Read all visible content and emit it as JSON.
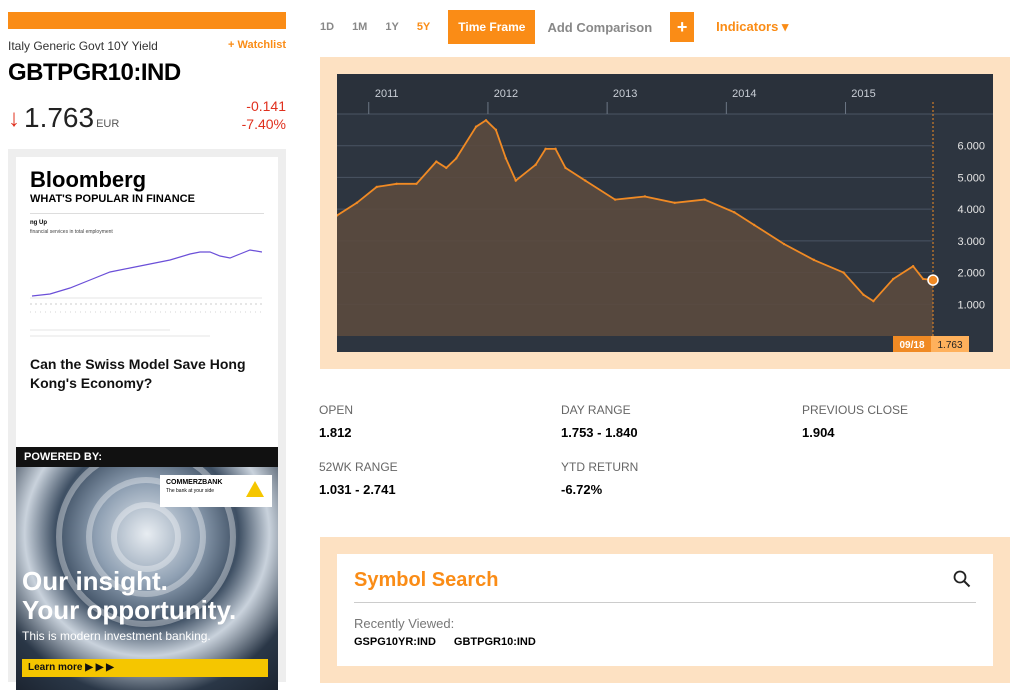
{
  "quote": {
    "name": "Italy Generic Govt 10Y Yield",
    "watchlist": "+ Watchlist",
    "ticker": "GBTPGR10:IND",
    "arrow": "↓",
    "price": "1.763",
    "currency": "EUR",
    "change": "-0.141",
    "change_pct": "-7.40%"
  },
  "ad": {
    "brand": "Bloomberg",
    "subtitle": "WHAT'S POPULAR IN FINANCE",
    "mini_chart_title": "ng Up",
    "mini_chart_subtitle": "financial services in total employment",
    "headline": "Can the Swiss Model Save Hong Kong's Economy?",
    "powered_by": "POWERED BY:",
    "sponsor": "COMMERZBANK",
    "sponsor_tagline": "The bank at your side",
    "big_text_1": "Our insight.",
    "big_text_2": "Your opportunity.",
    "small_text": "This is modern investment banking.",
    "cta": "Learn more ▶ ▶ ▶"
  },
  "toolbar": {
    "ranges": [
      "1D",
      "1M",
      "1Y",
      "5Y"
    ],
    "selected_range": "5Y",
    "time_frame": "Time Frame",
    "add_comparison": "Add Comparison",
    "plus": "+",
    "indicators": "Indicators ▾"
  },
  "chart_data": {
    "type": "area",
    "x_ticks": [
      "2011",
      "2012",
      "2013",
      "2014",
      "2015"
    ],
    "y_ticks": [
      "6.000",
      "5.000",
      "4.000",
      "3.000",
      "2.000",
      "1.000"
    ],
    "ylim": [
      0,
      7
    ],
    "x": [
      "2010-09",
      "2010-11",
      "2011-01",
      "2011-03",
      "2011-05",
      "2011-07",
      "2011-08",
      "2011-09",
      "2011-11",
      "2011-12",
      "2012-01",
      "2012-02",
      "2012-03",
      "2012-05",
      "2012-06",
      "2012-07",
      "2012-08",
      "2012-10",
      "2013-01",
      "2013-04",
      "2013-07",
      "2013-10",
      "2014-01",
      "2014-03",
      "2014-06",
      "2014-09",
      "2014-12",
      "2015-02",
      "2015-03",
      "2015-05",
      "2015-07",
      "2015-08",
      "2015-09"
    ],
    "y": [
      3.8,
      4.2,
      4.7,
      4.8,
      4.8,
      5.5,
      5.3,
      5.6,
      6.6,
      6.8,
      6.5,
      5.6,
      4.9,
      5.4,
      5.9,
      5.9,
      5.3,
      4.9,
      4.3,
      4.4,
      4.2,
      4.3,
      3.9,
      3.5,
      2.9,
      2.4,
      2.0,
      1.3,
      1.1,
      1.8,
      2.2,
      1.8,
      1.763
    ],
    "last_label_date": "09/18",
    "last_label_value": "1.763",
    "colors": {
      "line": "#f08a24",
      "background": "#2d3540",
      "fill": "#5b4a3e"
    }
  },
  "stats": [
    {
      "label": "OPEN",
      "value": "1.812"
    },
    {
      "label": "DAY RANGE",
      "value": "1.753 - 1.840"
    },
    {
      "label": "PREVIOUS CLOSE",
      "value": "1.904"
    },
    {
      "label": "52WK RANGE",
      "value": "1.031 - 2.741"
    },
    {
      "label": "YTD RETURN",
      "value": "-6.72%"
    }
  ],
  "search": {
    "title": "Symbol Search",
    "recent_label": "Recently Viewed:",
    "recent": [
      "GSPG10YR:IND",
      "GBTPGR10:IND"
    ]
  }
}
